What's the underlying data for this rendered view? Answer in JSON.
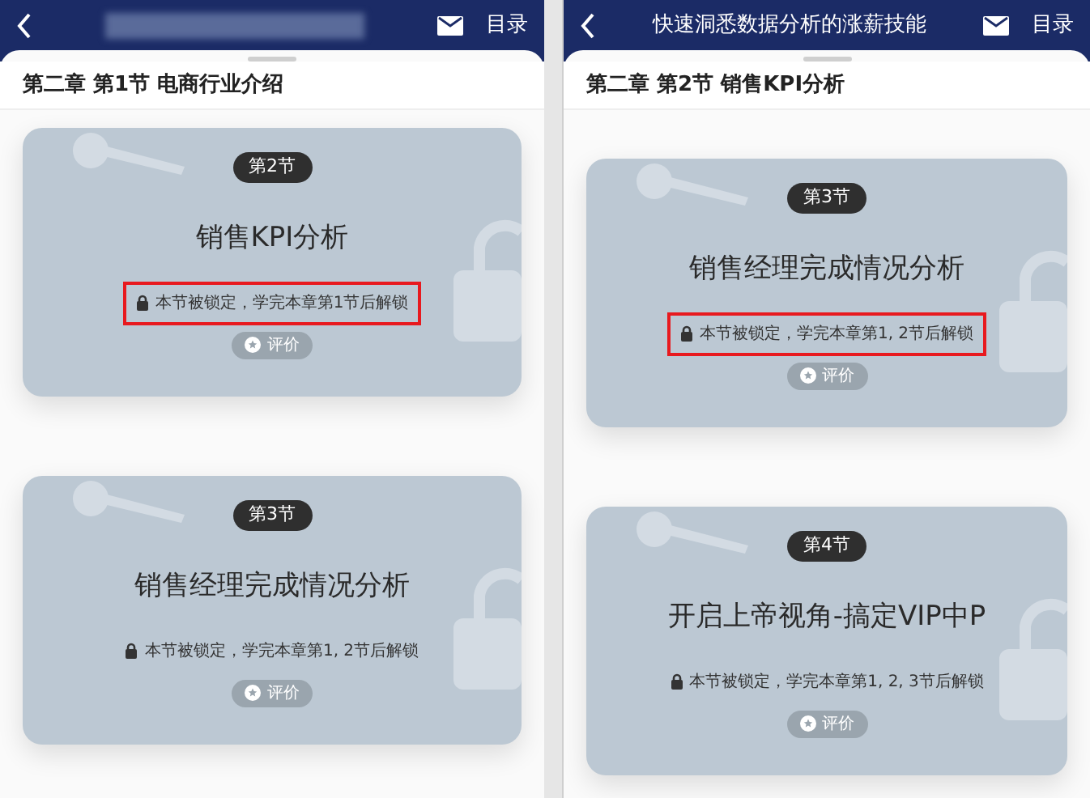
{
  "panels": [
    {
      "header": {
        "title_blurred": true,
        "menu_label": "目录"
      },
      "chapter_title": "第二章 第1节 电商行业介绍",
      "cards": [
        {
          "badge": "第2节",
          "title": "销售KPI分析",
          "lock_text": "本节被锁定，学完本章第1节后解锁",
          "rating_label": "评价",
          "highlighted": true
        },
        {
          "badge": "第3节",
          "title": "销售经理完成情况分析",
          "lock_text": "本节被锁定，学完本章第1, 2节后解锁",
          "rating_label": "评价",
          "highlighted": false
        }
      ]
    },
    {
      "header": {
        "title_blurred": false,
        "title": "快速洞悉数据分析的涨薪技能",
        "menu_label": "目录"
      },
      "chapter_title": "第二章 第2节 销售KPI分析",
      "cards": [
        {
          "badge": "第3节",
          "title": "销售经理完成情况分析",
          "lock_text": "本节被锁定，学完本章第1, 2节后解锁",
          "rating_label": "评价",
          "highlighted": true
        },
        {
          "badge": "第4节",
          "title": "开启上帝视角-搞定VIP中P",
          "lock_text": "本节被锁定，学完本章第1, 2, 3节后解锁",
          "rating_label": "评价",
          "highlighted": false
        }
      ]
    }
  ]
}
